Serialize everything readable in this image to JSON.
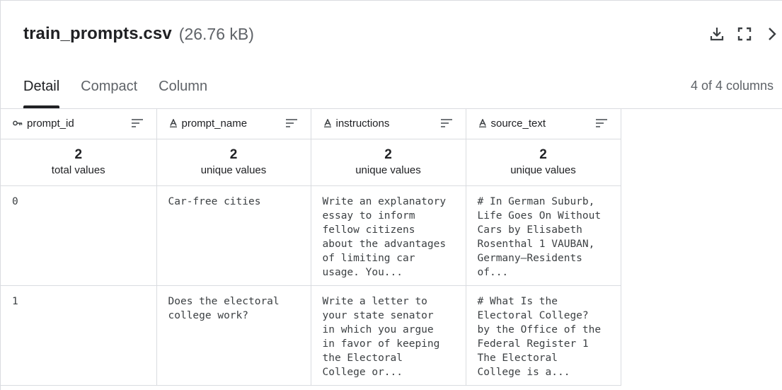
{
  "file": {
    "name": "train_prompts.csv",
    "size": "(26.76 kB)"
  },
  "actions": {
    "download_icon": "download-icon",
    "fullscreen_icon": "expand-icon",
    "next_icon": "chevron-right-icon"
  },
  "tabs": [
    {
      "label": "Detail",
      "active": true
    },
    {
      "label": "Compact",
      "active": false
    },
    {
      "label": "Column",
      "active": false
    }
  ],
  "column_count": "4 of 4 columns",
  "columns": [
    {
      "type_icon": "key-icon",
      "name": "prompt_id",
      "count": "2",
      "count_label": "total values"
    },
    {
      "type_icon": "text-type-icon",
      "name": "prompt_name",
      "count": "2",
      "count_label": "unique values"
    },
    {
      "type_icon": "text-type-icon",
      "name": "instructions",
      "count": "2",
      "count_label": "unique values"
    },
    {
      "type_icon": "text-type-icon",
      "name": "source_text",
      "count": "2",
      "count_label": "unique values"
    }
  ],
  "rows": [
    {
      "prompt_id": "0",
      "prompt_name": "Car-free cities",
      "instructions": "Write an explanatory\nessay to inform\nfellow citizens\nabout the advantages\nof limiting car\nusage. You...",
      "source_text": "# In German Suburb,\nLife Goes On Without\nCars by Elisabeth\nRosenthal 1 VAUBAN,\nGermany—Residents\nof..."
    },
    {
      "prompt_id": "1",
      "prompt_name": "Does the electoral\ncollege work?",
      "instructions": "Write a letter to\nyour state senator\nin which you argue\nin favor of keeping\nthe Electoral\nCollege or...",
      "source_text": "# What Is the\nElectoral College?\nby the Office of the\nFederal Register 1\nThe Electoral\nCollege is a..."
    }
  ]
}
